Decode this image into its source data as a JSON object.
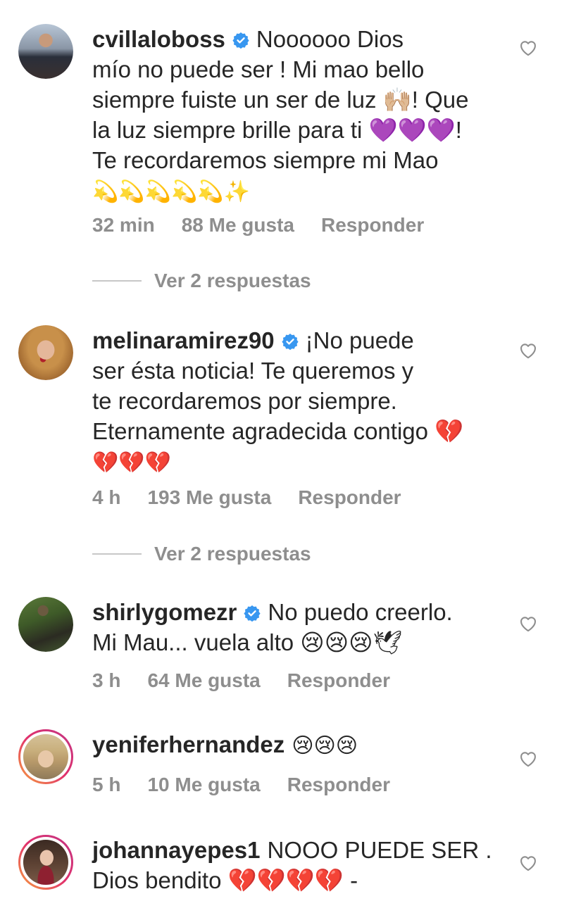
{
  "colors": {
    "text": "#262626",
    "muted": "#8e8e8e",
    "verified": "#3897f0",
    "line": "#c7c7c7"
  },
  "icons": {
    "verified": "verified-badge-icon",
    "like": "heart-outline-icon"
  },
  "comments": [
    {
      "username": "cvillaloboss",
      "verified": true,
      "text_lines": [
        "Noooooo Dios",
        "mío no puede ser ! Mi mao bello",
        "siempre fuiste un ser de luz 🙌🏼! Que",
        "la luz siempre brille para ti 💜💜💜!",
        "Te recordaremos siempre mi Mao",
        "💫💫💫💫💫✨"
      ],
      "time": "32 min",
      "likes": "88 Me gusta",
      "reply": "Responder",
      "view_replies": "Ver 2 respuestas"
    },
    {
      "username": "melinaramirez90",
      "verified": true,
      "text_lines": [
        "¡No puede",
        "ser ésta noticia! Te queremos y",
        "te recordaremos por siempre.",
        "Eternamente agradecida contigo 💔",
        "💔💔💔"
      ],
      "time": "4 h",
      "likes": "193 Me gusta",
      "reply": "Responder",
      "view_replies": "Ver 2 respuestas"
    },
    {
      "username": "shirlygomezr",
      "verified": true,
      "text_lines": [
        "No puedo creerlo.",
        "Mi Mau... vuela alto 😢😢😢🕊"
      ],
      "time": "3 h",
      "likes": "64 Me gusta",
      "reply": "Responder"
    },
    {
      "username": "yeniferhernandez",
      "verified": false,
      "text_lines": [
        "😢😢😢"
      ],
      "time": "5 h",
      "likes": "10 Me gusta",
      "reply": "Responder"
    },
    {
      "username": "johannayepes1",
      "verified": false,
      "text_lines": [
        "NOOO PUEDE SER .",
        "Dios bendito 💔💔💔💔 -"
      ]
    }
  ]
}
